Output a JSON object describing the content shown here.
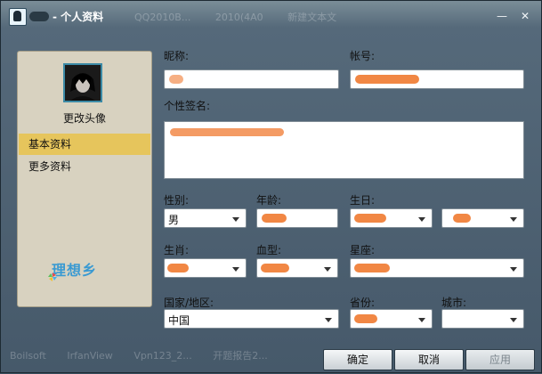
{
  "window": {
    "title": "- 个人资料",
    "background_taskbar_top": [
      "QQ2010B...",
      "2010(4A0",
      "新建文本文"
    ],
    "background_taskbar_bottom": [
      "Boilsoft",
      "IrfanView",
      "Vpn123_2...",
      "开题报告2..."
    ],
    "minimize_glyph": "—",
    "close_glyph": "✕"
  },
  "left_panel": {
    "change_avatar_label": "更改头像",
    "nav_items": [
      "基本资料",
      "更多资料"
    ],
    "brand_text": "理想乡"
  },
  "form": {
    "nickname_label": "昵称:",
    "account_label": "帐号:",
    "signature_label": "个性签名:",
    "gender_label": "性别:",
    "gender_value": "男",
    "age_label": "年龄:",
    "birthday_label": "生日:",
    "zodiac_label": "生肖:",
    "blood_label": "血型:",
    "constellation_label": "星座:",
    "country_label": "国家/地区:",
    "country_value": "中国",
    "province_label": "省份:",
    "city_label": "城市:"
  },
  "buttons": {
    "ok": "确定",
    "cancel": "取消",
    "apply": "应用"
  },
  "colors": {
    "accent_active_nav": "#e6c55c",
    "redaction": "#f07a30",
    "brand": "#3a9ad2"
  }
}
